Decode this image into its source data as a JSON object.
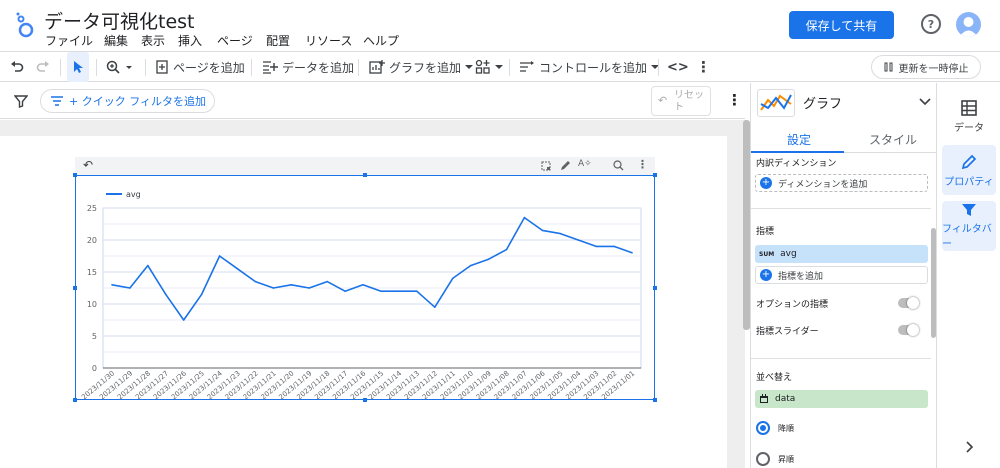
{
  "app": {
    "title": "データ可視化test",
    "menus": [
      "ファイル",
      "編集",
      "表示",
      "挿入",
      "ページ",
      "配置",
      "リソース",
      "ヘルプ"
    ],
    "share_label": "保存して共有",
    "help_label": "?"
  },
  "toolbar": {
    "add_page": "ページを追加",
    "add_data": "データを追加",
    "add_chart": "グラフを追加",
    "add_control": "コントロールを追加",
    "code_label": "<>",
    "pause_label": "更新を一時停止"
  },
  "filterbar": {
    "quick_filter": "+ クイック フィルタを追加",
    "reset_label": "リセット"
  },
  "panel": {
    "chart_type": "グラフ",
    "tabs": [
      "設定",
      "スタイル"
    ],
    "drilldown_dimension": "内訳ディメンション",
    "add_dimension": "ディメンションを追加",
    "metric_heading": "指標",
    "metric_agg": "SUM",
    "metric_name": "avg",
    "add_metric": "指標を追加",
    "optional_metrics": "オプションの指標",
    "metric_slider": "指標スライダー",
    "sort_heading": "並べ替え",
    "sort_field": "data",
    "sort_desc": "降順",
    "sort_asc": "昇順"
  },
  "rail": {
    "data": "データ",
    "properties": "プロパティ",
    "filterbar": "フィルタバー"
  },
  "colors": {
    "accent": "#1a73e8",
    "series": "#1a73e8",
    "metric_chip": "#c6e2fb",
    "dimension_chip": "#c8e6c9",
    "rail_active": "#e8f0fe"
  },
  "chart_data": {
    "type": "line",
    "x": [
      "2023/11/30",
      "2023/11/29",
      "2023/11/28",
      "2023/11/27",
      "2023/11/26",
      "2023/11/25",
      "2023/11/24",
      "2023/11/23",
      "2023/11/22",
      "2023/11/21",
      "2023/11/20",
      "2023/11/19",
      "2023/11/18",
      "2023/11/17",
      "2023/11/16",
      "2023/11/15",
      "2023/11/14",
      "2023/11/13",
      "2023/11/12",
      "2023/11/11",
      "2023/11/10",
      "2023/11/09",
      "2023/11/08",
      "2023/11/07",
      "2023/11/06",
      "2023/11/05",
      "2023/11/04",
      "2023/11/03",
      "2023/11/02",
      "2023/11/01"
    ],
    "series": [
      {
        "name": "avg",
        "values": [
          13,
          12.5,
          16,
          11.5,
          7.5,
          11.5,
          17.5,
          15.5,
          13.5,
          12.5,
          13,
          12.5,
          13.5,
          12,
          13,
          12,
          12,
          12,
          9.5,
          14,
          16,
          17,
          18.5,
          23.5,
          21.5,
          21,
          20,
          19,
          19,
          18
        ]
      }
    ],
    "yticks": [
      0,
      5,
      10,
      15,
      20,
      25
    ],
    "ylim": [
      0,
      25
    ],
    "legend": "top-left",
    "grid": true
  }
}
